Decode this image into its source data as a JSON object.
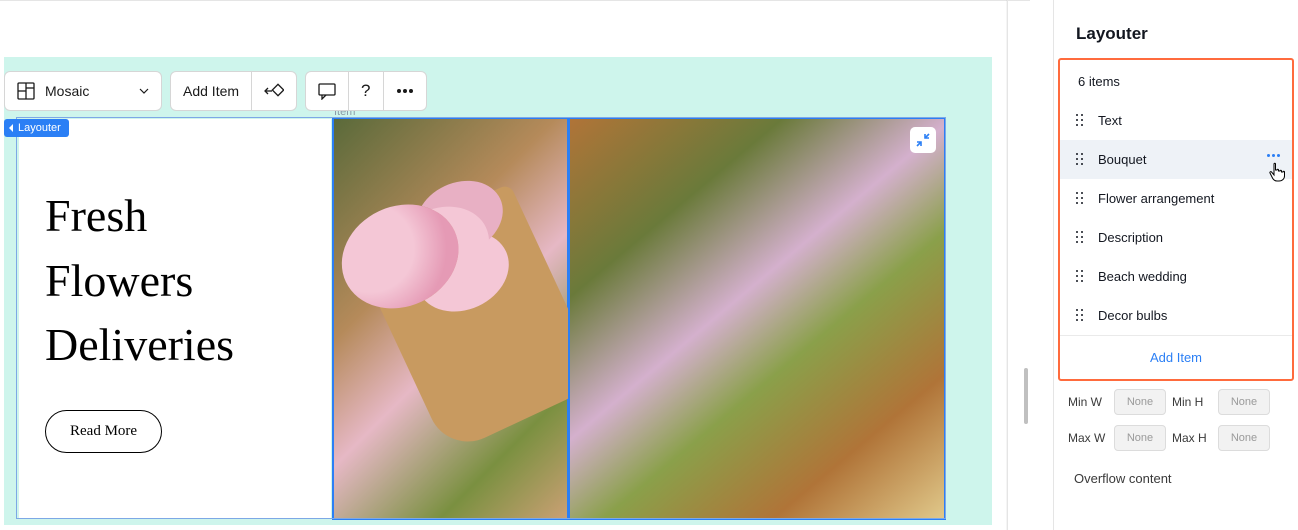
{
  "toolbar": {
    "layout_label": "Mosaic",
    "add_item_label": "Add Item"
  },
  "canvas": {
    "selection_label": "Layouter",
    "item_label": "Item",
    "heading": "Fresh Flowers Deliveries",
    "read_more_label": "Read More"
  },
  "panel": {
    "title": "Layouter",
    "count_label": "6 items",
    "items": [
      {
        "label": "Text"
      },
      {
        "label": "Bouquet"
      },
      {
        "label": "Flower arrangement"
      },
      {
        "label": "Description"
      },
      {
        "label": "Beach wedding"
      },
      {
        "label": "Decor bulbs"
      }
    ],
    "add_item_label": "Add Item",
    "size": {
      "minw_label": "Min W",
      "minw_value": "None",
      "minh_label": "Min H",
      "minh_value": "None",
      "maxw_label": "Max W",
      "maxw_value": "None",
      "maxh_label": "Max H",
      "maxh_value": "None"
    },
    "overflow_label": "Overflow content"
  }
}
